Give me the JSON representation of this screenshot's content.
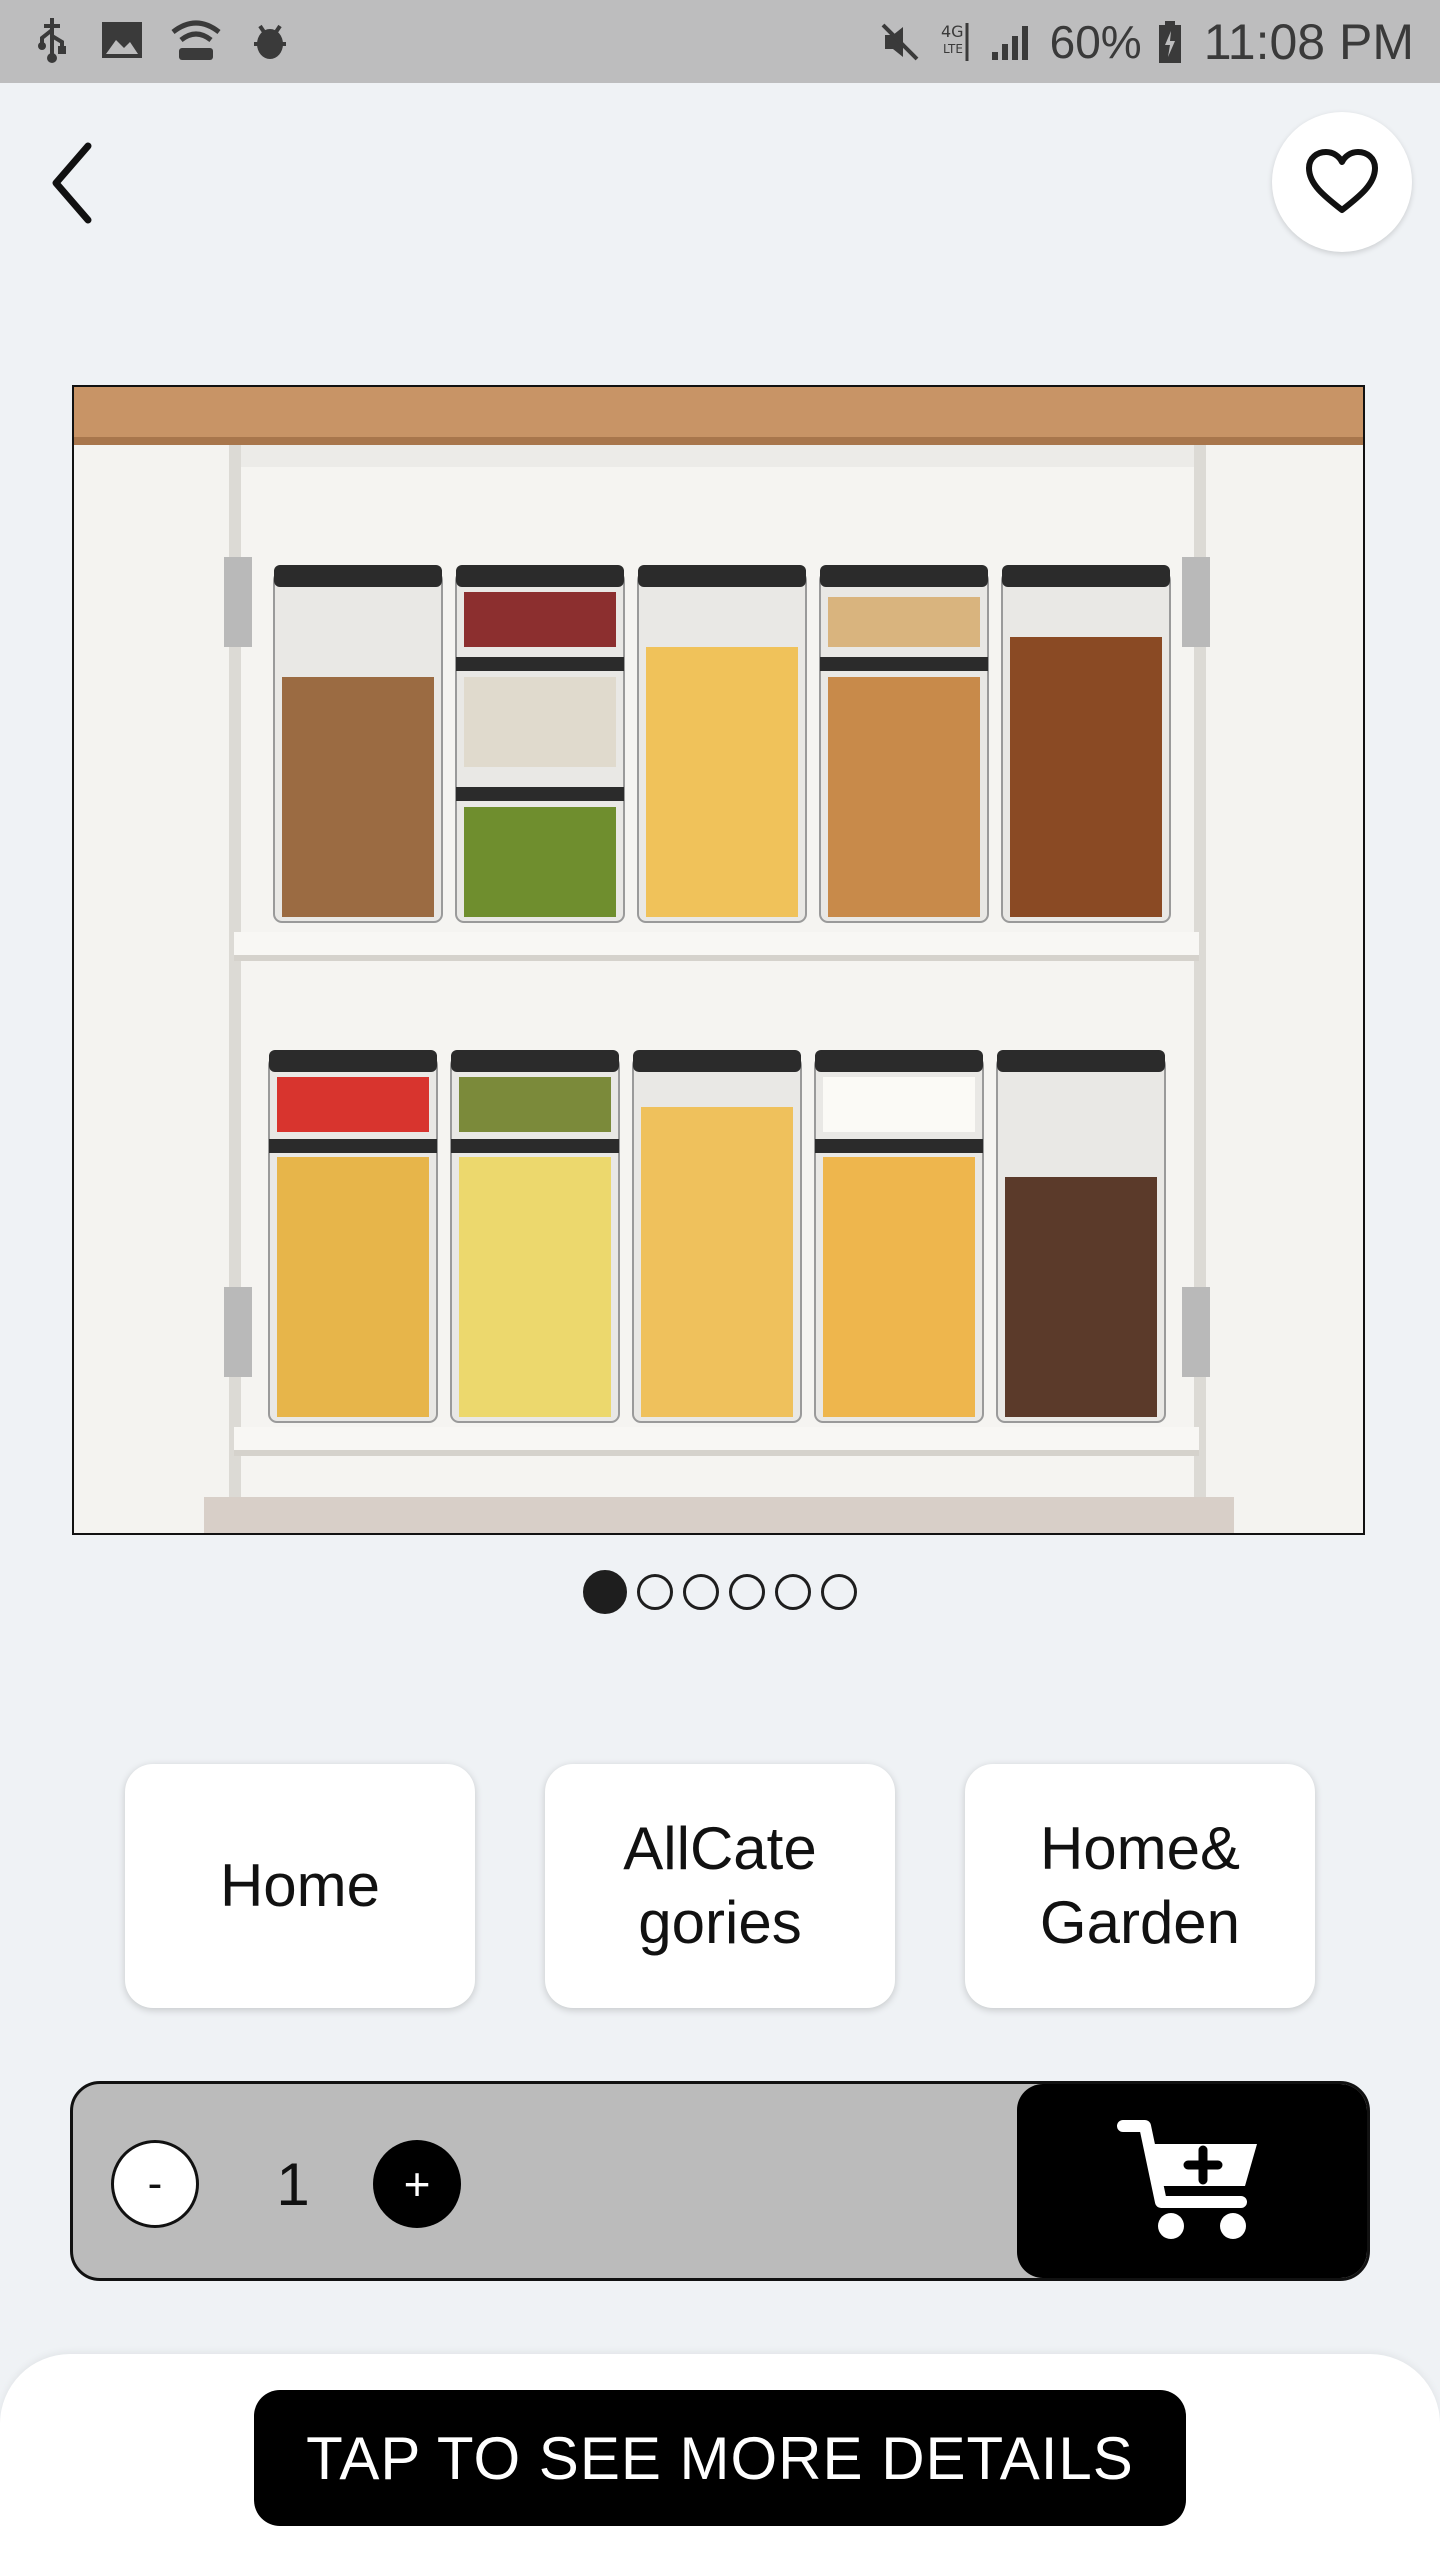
{
  "status_bar": {
    "battery": "60%",
    "time": "11:08 PM",
    "icons": [
      "usb-icon",
      "image-icon",
      "wifi-hotspot-icon",
      "bug-icon",
      "mute-icon",
      "4g-lte-icon",
      "signal-icon",
      "battery-icon"
    ]
  },
  "header": {
    "back_icon": "chevron-left-icon",
    "favorite_icon": "heart-outline-icon"
  },
  "product": {
    "image_subject": "kitchen cabinet with stacked clear food storage containers",
    "gallery_count": 6,
    "gallery_active_index": 0
  },
  "categories": [
    {
      "label": "Home"
    },
    {
      "label": "AllCategories"
    },
    {
      "label": "Home&Garden"
    }
  ],
  "cart": {
    "minus_label": "-",
    "quantity": "1",
    "plus_label": "+",
    "add_to_cart_icon": "cart-plus-icon"
  },
  "bottom": {
    "details_label": "TAP TO SEE MORE DETAILS"
  },
  "colors": {
    "background": "#eff2f5",
    "status_bar": "#bdbdbe",
    "cart_bar": "#bbbbbb",
    "primary_button": "#000000"
  }
}
